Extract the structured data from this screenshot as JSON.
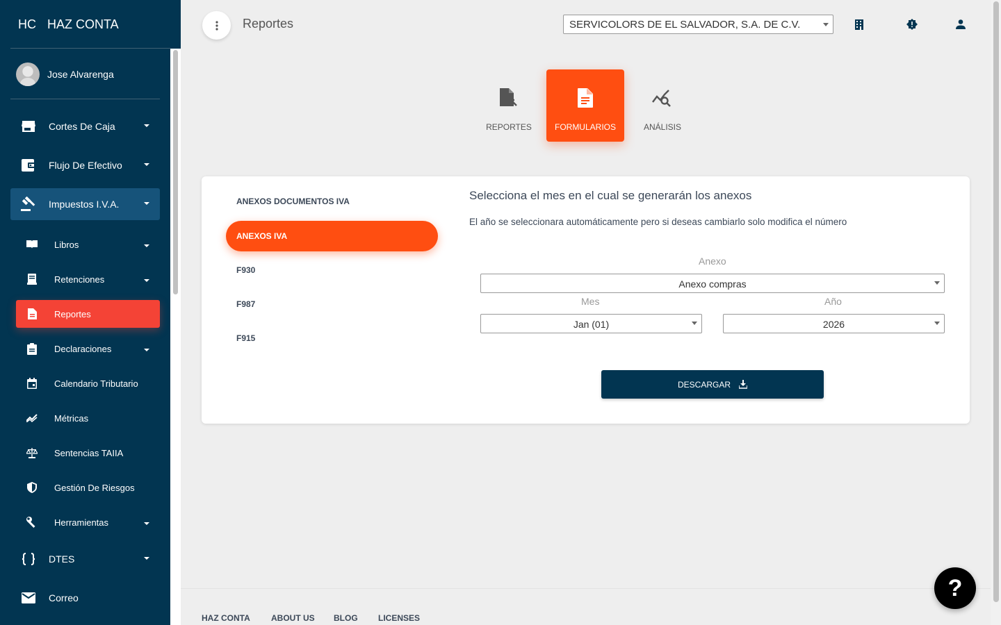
{
  "brand": {
    "mini": "HC",
    "name": "HAZ CONTA"
  },
  "user": {
    "name": "Jose Alvarenga"
  },
  "sidebar": {
    "items": [
      {
        "label": "Cortes De Caja",
        "icon": "store-icon"
      },
      {
        "label": "Flujo De Efectivo",
        "icon": "wallet-icon"
      },
      {
        "label": "Impuestos I.V.A.",
        "icon": "gavel-icon"
      },
      {
        "label": "DTES",
        "icon": "code-braces-icon"
      },
      {
        "label": "Correo",
        "icon": "mail-icon"
      }
    ],
    "subitems": [
      {
        "label": "Libros",
        "icon": "book-icon"
      },
      {
        "label": "Retenciones",
        "icon": "receipt-icon"
      },
      {
        "label": "Reportes",
        "icon": "document-icon"
      },
      {
        "label": "Declaraciones",
        "icon": "clipboard-icon"
      },
      {
        "label": "Calendario Tributario",
        "icon": "calendar-icon"
      },
      {
        "label": "Métricas",
        "icon": "trend-icon"
      },
      {
        "label": "Sentencias TAIIA",
        "icon": "balance-icon"
      },
      {
        "label": "Gestión De Riesgos",
        "icon": "shield-icon"
      },
      {
        "label": "Herramientas",
        "icon": "wrench-icon"
      }
    ]
  },
  "header": {
    "title": "Reportes",
    "company": "SERVICOLORS DE EL SALVADOR, S.A. DE C.V."
  },
  "tabs": [
    {
      "label": "REPORTES",
      "icon": "report-icon"
    },
    {
      "label": "FORMULARIOS",
      "icon": "form-icon"
    },
    {
      "label": "ANÁLISIS",
      "icon": "analysis-icon"
    }
  ],
  "pills": [
    {
      "label": "ANEXOS DOCUMENTOS IVA"
    },
    {
      "label": "ANEXOS IVA"
    },
    {
      "label": "F930"
    },
    {
      "label": "F987"
    },
    {
      "label": "F915"
    }
  ],
  "form": {
    "title": "Selecciona el mes en el cual se generarán los anexos",
    "subtitle": "El año se seleccionara automáticamente pero si deseas cambiarlo solo modifica el número",
    "anexo_label": "Anexo",
    "anexo_value": "Anexo compras",
    "mes_label": "Mes",
    "mes_value": "Jan (01)",
    "anio_label": "Año",
    "anio_value": "2026",
    "download_label": "DESCARGAR"
  },
  "footer": {
    "links": [
      "HAZ CONTA",
      "ABOUT US",
      "BLOG",
      "LICENSES"
    ]
  },
  "help": {
    "label": "?"
  },
  "colors": {
    "sidebar_bg": "#023551",
    "accent": "#ff4e11",
    "active_sub": "#f44336"
  }
}
